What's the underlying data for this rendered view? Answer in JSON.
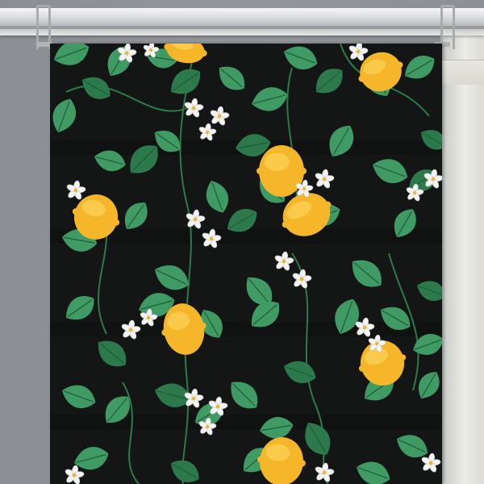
{
  "scene": {
    "subject": "panel-curtain-lemon-print",
    "colors": {
      "wall": "#8f9296",
      "fabric_background": "#131615",
      "leaf": "#3f9a63",
      "leaf_dark": "#2c7a4c",
      "lemon": "#f5b62a",
      "lemon_highlight": "#fcd45a",
      "blossom": "#f4f4f4",
      "blossom_center": "#e6b93a",
      "rail": "#d6d7d8"
    }
  }
}
